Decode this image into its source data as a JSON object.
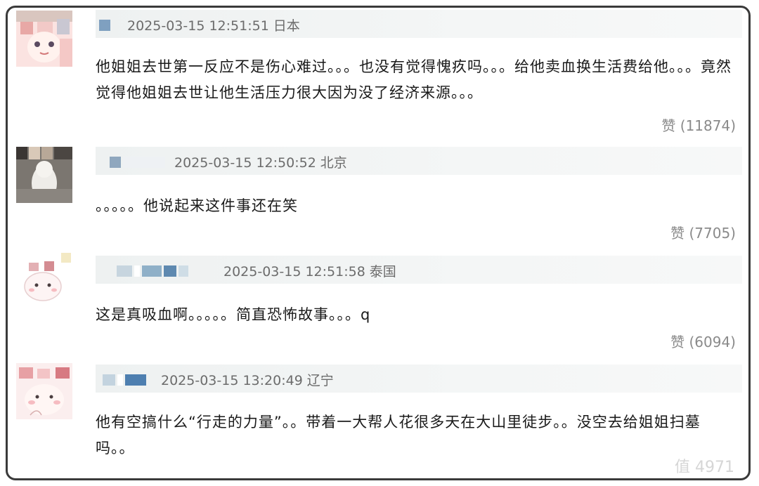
{
  "comments": [
    {
      "timestamp": "2025-03-15 12:51:51",
      "location": "日本",
      "text": "他姐姐去世第一反应不是伤心难过。。。也没有觉得愧疚吗。。。给他卖血换生活费给他。。。竟然觉得他姐姐去世让他生活压力很大因为没了经济来源。。。",
      "likes": "赞 (11874)"
    },
    {
      "timestamp": "2025-03-15 12:50:52",
      "location": "北京",
      "text": "。。。。。他说起来这件事还在笑",
      "likes": "赞 (7705)"
    },
    {
      "timestamp": "2025-03-15 12:51:58",
      "location": "泰国",
      "text": "这是真吸血啊。。。。。简直恐怖故事。。。q",
      "likes": "赞 (6094)"
    },
    {
      "timestamp": "2025-03-15 13:20:49",
      "location": "辽宁",
      "text": "他有空搞什么“行走的力量”。。带着一大帮人花很多天在大山里徒步。。没空去给姐姐扫墓吗。。",
      "likes": ""
    }
  ],
  "watermark": "值 4971"
}
